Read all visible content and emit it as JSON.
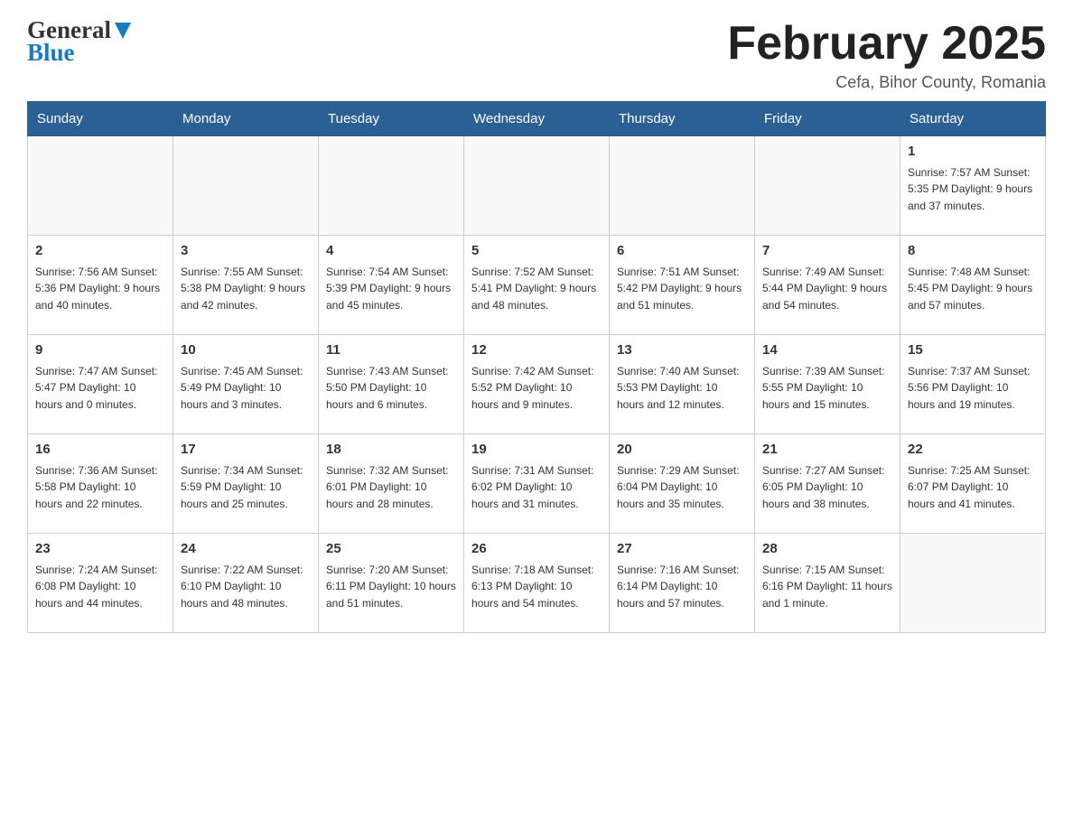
{
  "logo": {
    "general": "General",
    "blue": "Blue"
  },
  "title": "February 2025",
  "location": "Cefa, Bihor County, Romania",
  "days_of_week": [
    "Sunday",
    "Monday",
    "Tuesday",
    "Wednesday",
    "Thursday",
    "Friday",
    "Saturday"
  ],
  "weeks": [
    [
      {
        "day": "",
        "info": ""
      },
      {
        "day": "",
        "info": ""
      },
      {
        "day": "",
        "info": ""
      },
      {
        "day": "",
        "info": ""
      },
      {
        "day": "",
        "info": ""
      },
      {
        "day": "",
        "info": ""
      },
      {
        "day": "1",
        "info": "Sunrise: 7:57 AM\nSunset: 5:35 PM\nDaylight: 9 hours\nand 37 minutes."
      }
    ],
    [
      {
        "day": "2",
        "info": "Sunrise: 7:56 AM\nSunset: 5:36 PM\nDaylight: 9 hours\nand 40 minutes."
      },
      {
        "day": "3",
        "info": "Sunrise: 7:55 AM\nSunset: 5:38 PM\nDaylight: 9 hours\nand 42 minutes."
      },
      {
        "day": "4",
        "info": "Sunrise: 7:54 AM\nSunset: 5:39 PM\nDaylight: 9 hours\nand 45 minutes."
      },
      {
        "day": "5",
        "info": "Sunrise: 7:52 AM\nSunset: 5:41 PM\nDaylight: 9 hours\nand 48 minutes."
      },
      {
        "day": "6",
        "info": "Sunrise: 7:51 AM\nSunset: 5:42 PM\nDaylight: 9 hours\nand 51 minutes."
      },
      {
        "day": "7",
        "info": "Sunrise: 7:49 AM\nSunset: 5:44 PM\nDaylight: 9 hours\nand 54 minutes."
      },
      {
        "day": "8",
        "info": "Sunrise: 7:48 AM\nSunset: 5:45 PM\nDaylight: 9 hours\nand 57 minutes."
      }
    ],
    [
      {
        "day": "9",
        "info": "Sunrise: 7:47 AM\nSunset: 5:47 PM\nDaylight: 10 hours\nand 0 minutes."
      },
      {
        "day": "10",
        "info": "Sunrise: 7:45 AM\nSunset: 5:49 PM\nDaylight: 10 hours\nand 3 minutes."
      },
      {
        "day": "11",
        "info": "Sunrise: 7:43 AM\nSunset: 5:50 PM\nDaylight: 10 hours\nand 6 minutes."
      },
      {
        "day": "12",
        "info": "Sunrise: 7:42 AM\nSunset: 5:52 PM\nDaylight: 10 hours\nand 9 minutes."
      },
      {
        "day": "13",
        "info": "Sunrise: 7:40 AM\nSunset: 5:53 PM\nDaylight: 10 hours\nand 12 minutes."
      },
      {
        "day": "14",
        "info": "Sunrise: 7:39 AM\nSunset: 5:55 PM\nDaylight: 10 hours\nand 15 minutes."
      },
      {
        "day": "15",
        "info": "Sunrise: 7:37 AM\nSunset: 5:56 PM\nDaylight: 10 hours\nand 19 minutes."
      }
    ],
    [
      {
        "day": "16",
        "info": "Sunrise: 7:36 AM\nSunset: 5:58 PM\nDaylight: 10 hours\nand 22 minutes."
      },
      {
        "day": "17",
        "info": "Sunrise: 7:34 AM\nSunset: 5:59 PM\nDaylight: 10 hours\nand 25 minutes."
      },
      {
        "day": "18",
        "info": "Sunrise: 7:32 AM\nSunset: 6:01 PM\nDaylight: 10 hours\nand 28 minutes."
      },
      {
        "day": "19",
        "info": "Sunrise: 7:31 AM\nSunset: 6:02 PM\nDaylight: 10 hours\nand 31 minutes."
      },
      {
        "day": "20",
        "info": "Sunrise: 7:29 AM\nSunset: 6:04 PM\nDaylight: 10 hours\nand 35 minutes."
      },
      {
        "day": "21",
        "info": "Sunrise: 7:27 AM\nSunset: 6:05 PM\nDaylight: 10 hours\nand 38 minutes."
      },
      {
        "day": "22",
        "info": "Sunrise: 7:25 AM\nSunset: 6:07 PM\nDaylight: 10 hours\nand 41 minutes."
      }
    ],
    [
      {
        "day": "23",
        "info": "Sunrise: 7:24 AM\nSunset: 6:08 PM\nDaylight: 10 hours\nand 44 minutes."
      },
      {
        "day": "24",
        "info": "Sunrise: 7:22 AM\nSunset: 6:10 PM\nDaylight: 10 hours\nand 48 minutes."
      },
      {
        "day": "25",
        "info": "Sunrise: 7:20 AM\nSunset: 6:11 PM\nDaylight: 10 hours\nand 51 minutes."
      },
      {
        "day": "26",
        "info": "Sunrise: 7:18 AM\nSunset: 6:13 PM\nDaylight: 10 hours\nand 54 minutes."
      },
      {
        "day": "27",
        "info": "Sunrise: 7:16 AM\nSunset: 6:14 PM\nDaylight: 10 hours\nand 57 minutes."
      },
      {
        "day": "28",
        "info": "Sunrise: 7:15 AM\nSunset: 6:16 PM\nDaylight: 11 hours\nand 1 minute."
      },
      {
        "day": "",
        "info": ""
      }
    ]
  ]
}
